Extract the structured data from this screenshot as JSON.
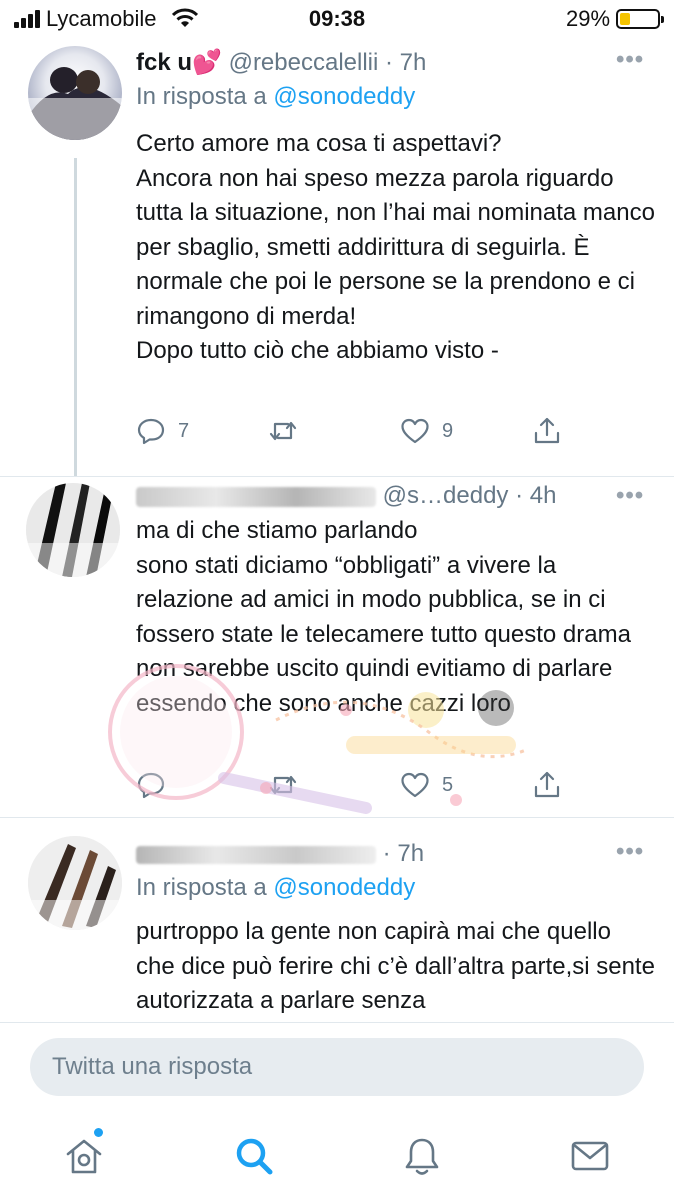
{
  "status_bar": {
    "carrier": "Lycamobile",
    "time": "09:38",
    "battery": "29%",
    "battery_level": 0.29
  },
  "tweets": [
    {
      "name": "fck u💕",
      "handle": "@rebeccalellii",
      "time": "7h",
      "reply_prefix": "In risposta a",
      "reply_to": "@sonodeddy",
      "text": "Certo amore ma cosa ti aspettavi?\nAncora non hai speso mezza parola riguardo tutta la situazione, non l’hai mai nominata manco per sbaglio, smetti addirittura di seguirla. È normale che poi le persone se la prendono e ci rimangono di merda!\nDopo tutto ciò che abbiamo visto -",
      "replies": "7",
      "retweets": "",
      "likes": "9"
    },
    {
      "name": "",
      "handle": "@s…deddy",
      "time": "4h",
      "text": "ma di che stiamo parlando\nsono stati diciamo “obbligati” a vivere la relazione ad amici in modo pubblica, se in ci fossero state le telecamere tutto questo drama non sarebbe uscito quindi evitiamo di parlare essendo che sono anche cazzi loro",
      "replies": "",
      "retweets": "",
      "likes": "5"
    },
    {
      "name": "",
      "handle": "",
      "time": "7h",
      "reply_prefix": "In risposta a",
      "reply_to": "@sonodeddy",
      "text": "purtroppo la gente non capirà mai che quello che dice può ferire chi c’è dall’altra parte,si sente autorizzata a parlare senza"
    }
  ],
  "composer": {
    "placeholder": "Twitta una risposta"
  },
  "tabs": [
    "home-icon",
    "search-icon",
    "notifications-icon",
    "messages-icon"
  ],
  "colors": {
    "accent": "#1da1f2",
    "secondary_text": "#657786",
    "battery": "#f5c400"
  }
}
